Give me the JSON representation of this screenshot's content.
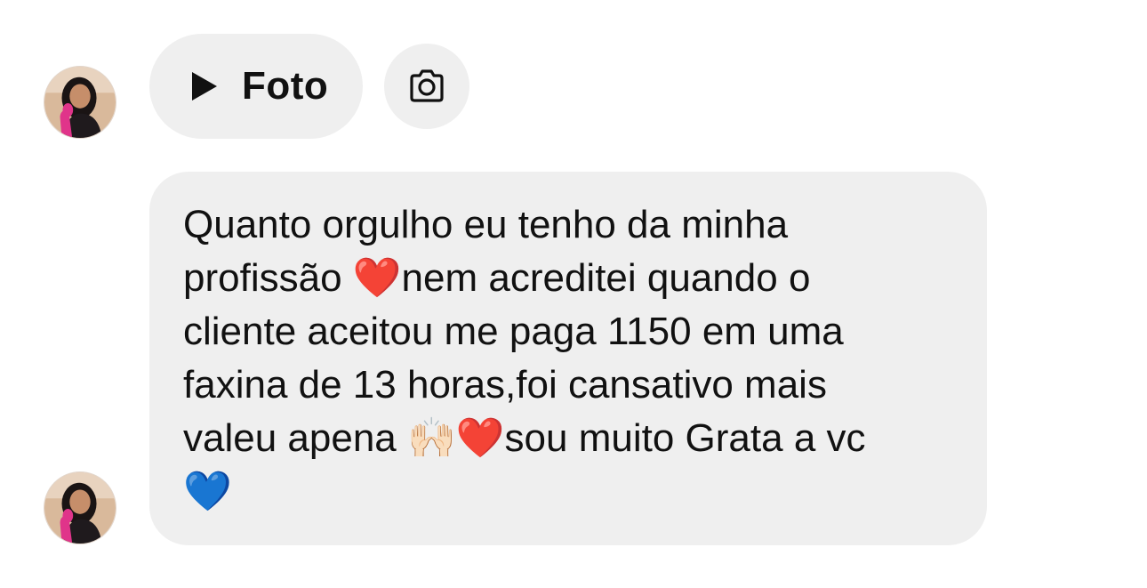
{
  "attachment": {
    "label": "Foto",
    "play_icon": "play-icon",
    "camera_icon": "camera-icon"
  },
  "message": {
    "text": "Quanto orgulho eu tenho da minha\nprofissão ❤️nem acreditei quando o\ncliente aceitou me paga 1150 em uma\nfaxina de 13 horas,foi cansativo mais\nvaleu apena 🙌🏻❤️sou muito Grata a vc\n💙"
  },
  "colors": {
    "bubble": "#efefef",
    "text": "#111111",
    "background": "#ffffff"
  }
}
